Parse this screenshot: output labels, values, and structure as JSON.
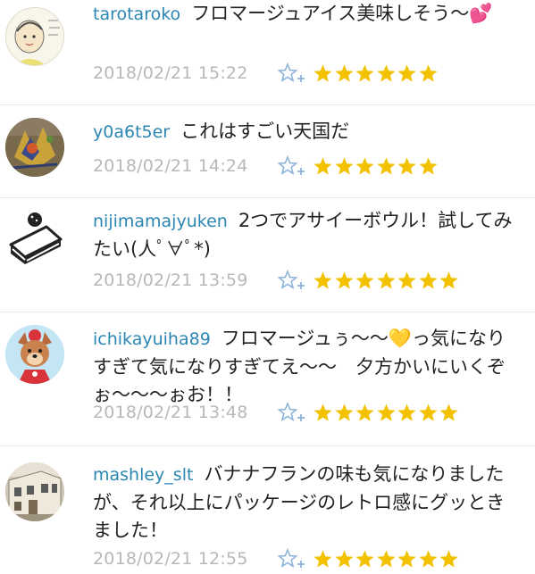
{
  "comments": [
    {
      "username": "tarotaroko",
      "text": "フロマージュアイス美味しそう〜💕",
      "timestamp": "2018/02/21 15:22",
      "star_count": 6,
      "avatar": "child-sketch-avatar"
    },
    {
      "username": "y0a6t5er",
      "text": "これはすごい天国だ",
      "timestamp": "2018/02/21 14:24",
      "star_count": 6,
      "avatar": "artwork-avatar"
    },
    {
      "username": "nijimamajyuken",
      "text": "2つでアサイーボウル！試してみたい(人ﾟ∀ﾟ*)",
      "timestamp": "2018/02/21 13:59",
      "star_count": 7,
      "avatar": "cake-icon-avatar"
    },
    {
      "username": "ichikayuiha89",
      "text": "フロマージュぅ〜〜💛っ気になりすぎて気になりすぎてえ〜〜　夕方かいにいくぞぉ〜〜〜ぉお！！",
      "timestamp": "2018/02/21 13:48",
      "star_count": 7,
      "avatar": "dog-character-avatar"
    },
    {
      "username": "mashley_slt",
      "text": "バナナフランの味も気になりましたが、それ以上にパッケージのレトロ感にグッときました！",
      "timestamp": "2018/02/21 12:55",
      "star_count": 7,
      "avatar": "building-photo-avatar"
    }
  ],
  "colors": {
    "username": "#2b86b3",
    "star": "#f2c200",
    "timestamp": "#b8b8b8",
    "fav_icon": "#8fb3d9"
  },
  "icons": {
    "add_star": "add-star-icon",
    "star": "star-icon"
  }
}
